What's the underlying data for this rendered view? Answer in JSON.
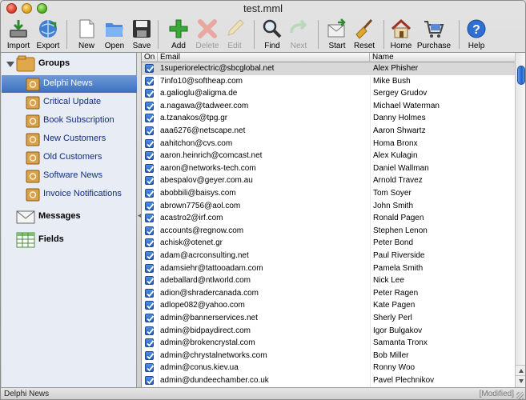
{
  "window": {
    "title": "test.mml"
  },
  "toolbar": {
    "import": "Import",
    "export": "Export",
    "new": "New",
    "open": "Open",
    "save": "Save",
    "add": "Add",
    "delete": "Delete",
    "edit": "Edit",
    "find": "Find",
    "next": "Next",
    "start": "Start",
    "reset": "Reset",
    "home": "Home",
    "purchase": "Purchase",
    "help": "Help"
  },
  "sidebar": {
    "groups_label": "Groups",
    "items": [
      {
        "label": "Delphi News",
        "selected": true
      },
      {
        "label": "Critical Update"
      },
      {
        "label": "Book Subscription"
      },
      {
        "label": "New Customers"
      },
      {
        "label": "Old Customers"
      },
      {
        "label": "Software News"
      },
      {
        "label": "Invoice Notifications"
      }
    ],
    "messages_label": "Messages",
    "fields_label": "Fields"
  },
  "table": {
    "columns": {
      "on": "On",
      "email": "Email",
      "name": "Name"
    },
    "rows": [
      {
        "on": true,
        "email": "1superiorelectric@sbcglobal.net",
        "name": "Alex Phisher",
        "selected": true
      },
      {
        "on": true,
        "email": "7info10@softheap.com",
        "name": "Mike Bush"
      },
      {
        "on": true,
        "email": "a.galioglu@aligma.de",
        "name": "Sergey Grudov"
      },
      {
        "on": true,
        "email": "a.nagawa@tadweer.com",
        "name": "Michael Waterman"
      },
      {
        "on": true,
        "email": "a.tzanakos@tpg.gr",
        "name": "Danny Holmes"
      },
      {
        "on": true,
        "email": "aaa6276@netscape.net",
        "name": "Aaron Shwartz"
      },
      {
        "on": true,
        "email": "aahitchon@cvs.com",
        "name": "Homa Bronx"
      },
      {
        "on": true,
        "email": "aaron.heinrich@comcast.net",
        "name": "Alex Kulagin"
      },
      {
        "on": true,
        "email": "aaron@networks-tech.com",
        "name": "Daniel Wallman"
      },
      {
        "on": true,
        "email": "abespalov@geyer.com.au",
        "name": "Arnold Travez"
      },
      {
        "on": true,
        "email": "abobbili@baisys.com",
        "name": "Tom Soyer"
      },
      {
        "on": true,
        "email": "abrown7756@aol.com",
        "name": "John Smith"
      },
      {
        "on": true,
        "email": "acastro2@irf.com",
        "name": "Ronald Pagen"
      },
      {
        "on": true,
        "email": "accounts@regnow.com",
        "name": "Stephen Lenon"
      },
      {
        "on": true,
        "email": "achisk@otenet.gr",
        "name": "Peter Bond"
      },
      {
        "on": true,
        "email": "adam@acrconsulting.net",
        "name": "Paul Riverside"
      },
      {
        "on": true,
        "email": "adamsiehr@tattooadam.com",
        "name": "Pamela Smith"
      },
      {
        "on": true,
        "email": "adeballard@ntlworld.com",
        "name": "Nick Lee"
      },
      {
        "on": true,
        "email": "adion@shradercanada.com",
        "name": "Peter Ragen"
      },
      {
        "on": true,
        "email": "adlope082@yahoo.com",
        "name": "Kate Pagen"
      },
      {
        "on": true,
        "email": "admin@bannerservices.net",
        "name": "Sherly Perl"
      },
      {
        "on": true,
        "email": "admin@bidpaydirect.com",
        "name": "Igor Bulgakov"
      },
      {
        "on": true,
        "email": "admin@brokencrystal.com",
        "name": "Samanta Tronx"
      },
      {
        "on": true,
        "email": "admin@chrystalnetworks.com",
        "name": "Bob Miller"
      },
      {
        "on": true,
        "email": "admin@conus.kiev.ua",
        "name": "Ronny Woo"
      },
      {
        "on": true,
        "email": "admin@dundeechamber.co.uk",
        "name": "Pavel Plechnikov"
      }
    ]
  },
  "status": {
    "left": "Delphi News",
    "right": "[Modified]"
  },
  "colors": {
    "selection": "#3d6fbf",
    "checkbox": "#1f5fc0"
  }
}
